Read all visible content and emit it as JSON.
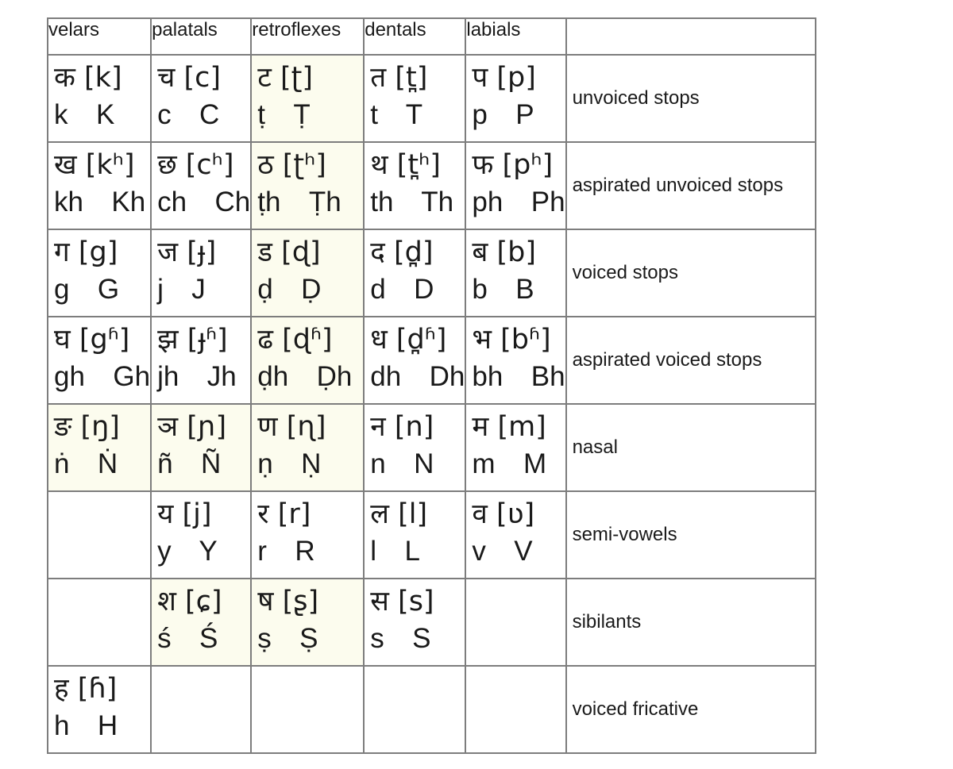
{
  "headers": [
    "velars",
    "palatals",
    "retroflexes",
    "dentals",
    "labials"
  ],
  "highlight_color": "#fcfcee",
  "border_color": "#7d7d7d",
  "rows": [
    {
      "description": "unvoiced stops",
      "cells": [
        {
          "dev": "क",
          "ipa": "[k]",
          "roman": "k  K",
          "highlight": false
        },
        {
          "dev": "च",
          "ipa": "[c]",
          "roman": "c  C",
          "highlight": false
        },
        {
          "dev": "ट",
          "ipa": "[ʈ]",
          "roman": "ṭ  Ṭ",
          "highlight": true
        },
        {
          "dev": "त",
          "ipa": "[t̪]",
          "roman": "t  T",
          "highlight": false
        },
        {
          "dev": "प",
          "ipa": "[p]",
          "roman": "p  P",
          "highlight": false
        }
      ]
    },
    {
      "description": "aspirated unvoiced stops",
      "cells": [
        {
          "dev": "ख",
          "ipa": "[kʰ]",
          "roman": "kh  Kh",
          "highlight": false
        },
        {
          "dev": "छ",
          "ipa": "[cʰ]",
          "roman": "ch  Ch",
          "highlight": false
        },
        {
          "dev": "ठ",
          "ipa": "[ʈʰ]",
          "roman": "ṭh  Ṭh",
          "highlight": true
        },
        {
          "dev": "थ",
          "ipa": "[t̪ʰ]",
          "roman": "th  Th",
          "highlight": false
        },
        {
          "dev": "फ",
          "ipa": "[pʰ]",
          "roman": "ph  Ph",
          "highlight": false
        }
      ]
    },
    {
      "description": "voiced stops",
      "cells": [
        {
          "dev": "ग",
          "ipa": "[g]",
          "roman": "g  G",
          "highlight": false
        },
        {
          "dev": "ज",
          "ipa": "[ɟ]",
          "roman": "j  J",
          "highlight": false
        },
        {
          "dev": "ड",
          "ipa": "[ɖ]",
          "roman": "ḍ  Ḍ",
          "highlight": true
        },
        {
          "dev": "द",
          "ipa": "[d̪]",
          "roman": "d  D",
          "highlight": false
        },
        {
          "dev": "ब",
          "ipa": "[b]",
          "roman": "b  B",
          "highlight": false
        }
      ]
    },
    {
      "description": "aspirated voiced stops",
      "cells": [
        {
          "dev": "घ",
          "ipa": "[gʱ]",
          "roman": "gh  Gh",
          "highlight": false
        },
        {
          "dev": "झ",
          "ipa": "[ɟʱ]",
          "roman": "jh  Jh",
          "highlight": false
        },
        {
          "dev": "ढ",
          "ipa": "[ɖʱ]",
          "roman": "ḍh  Ḍh",
          "highlight": true
        },
        {
          "dev": "ध",
          "ipa": "[d̪ʱ]",
          "roman": "dh  Dh",
          "highlight": false
        },
        {
          "dev": "भ",
          "ipa": "[bʱ]",
          "roman": "bh  Bh",
          "highlight": false
        }
      ]
    },
    {
      "description": "nasal",
      "cells": [
        {
          "dev": "ङ",
          "ipa": "[ŋ]",
          "roman": "ṅ  Ṅ",
          "highlight": true
        },
        {
          "dev": "ञ",
          "ipa": "[ɲ]",
          "roman": "ñ  Ñ",
          "highlight": true
        },
        {
          "dev": "ण",
          "ipa": "[ɳ]",
          "roman": "ṇ  Ṇ",
          "highlight": true
        },
        {
          "dev": "न",
          "ipa": "[n]",
          "roman": "n  N",
          "highlight": false
        },
        {
          "dev": "म",
          "ipa": "[m]",
          "roman": "m  M",
          "highlight": false
        }
      ]
    },
    {
      "description": "semi-vowels",
      "cells": [
        null,
        {
          "dev": "य",
          "ipa": "[j]",
          "roman": "y  Y",
          "highlight": false
        },
        {
          "dev": "र",
          "ipa": "[r]",
          "roman": "r  R",
          "highlight": false
        },
        {
          "dev": "ल",
          "ipa": "[l]",
          "roman": "l  L",
          "highlight": false
        },
        {
          "dev": "व",
          "ipa": "[ʋ]",
          "roman": "v  V",
          "highlight": false
        }
      ]
    },
    {
      "description": "sibilants",
      "cells": [
        null,
        {
          "dev": "श",
          "ipa": " [ɕ]",
          "roman": "ś  Ś",
          "highlight": true
        },
        {
          "dev": "ष",
          "ipa": "[ʂ]",
          "roman": "ṣ  Ṣ",
          "highlight": true
        },
        {
          "dev": "स",
          "ipa": "[s]",
          "roman": "s  S",
          "highlight": false
        },
        null
      ]
    },
    {
      "description": "voiced fricative",
      "cells": [
        {
          "dev": "ह",
          "ipa": "[ɦ]",
          "roman": "h  H",
          "highlight": false
        },
        null,
        null,
        null,
        null
      ]
    }
  ]
}
